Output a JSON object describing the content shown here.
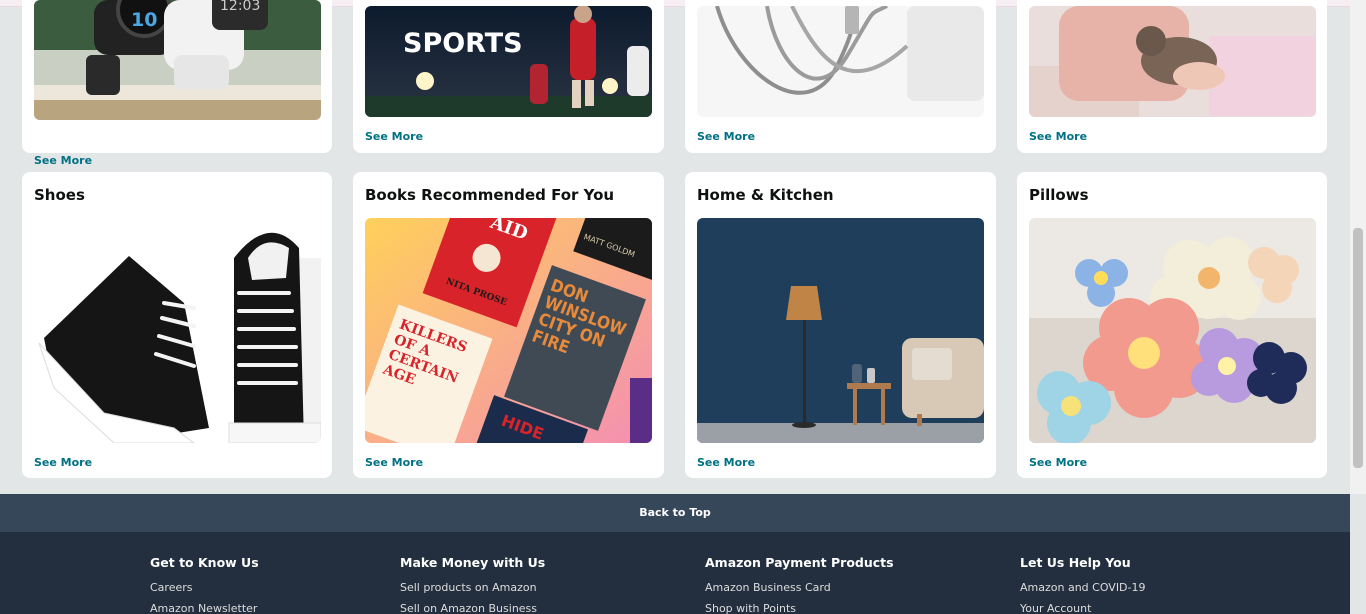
{
  "grid": {
    "top_row": [
      {
        "see_more": "See More"
      },
      {
        "see_more": "See More"
      },
      {
        "see_more": "See More"
      },
      {
        "see_more": "See More"
      }
    ],
    "bottom_row": [
      {
        "title": "Shoes",
        "see_more": "See More"
      },
      {
        "title": "Books Recommended For You",
        "see_more": "See More"
      },
      {
        "title": "Home & Kitchen",
        "see_more": "See More"
      },
      {
        "title": "Pillows",
        "see_more": "See More"
      }
    ],
    "sports_text": "SPORTS",
    "watch_time_a": "10",
    "watch_time_b": "12:03"
  },
  "books": {
    "book1": "AID",
    "book1_author": "NITA PROSE",
    "book2": "DON WINSLOW CITY ON FIRE",
    "book3": "KILLERS OF A CERTAIN AGE",
    "book4": "HIDE",
    "book5_author": "MATT GOLDM"
  },
  "footer": {
    "back_to_top": "Back to Top",
    "columns": [
      {
        "heading": "Get to Know Us",
        "links": [
          "Careers",
          "Amazon Newsletter"
        ]
      },
      {
        "heading": "Make Money with Us",
        "links": [
          "Sell products on Amazon",
          "Sell on Amazon Business"
        ]
      },
      {
        "heading": "Amazon Payment Products",
        "links": [
          "Amazon Business Card",
          "Shop with Points"
        ]
      },
      {
        "heading": "Let Us Help You",
        "links": [
          "Amazon and COVID-19",
          "Your Account"
        ]
      }
    ]
  },
  "colors": {
    "link": "#007185",
    "backtop_bg": "#37475a",
    "footer_bg": "#232f3e",
    "page_bg": "#e3e6e6"
  }
}
